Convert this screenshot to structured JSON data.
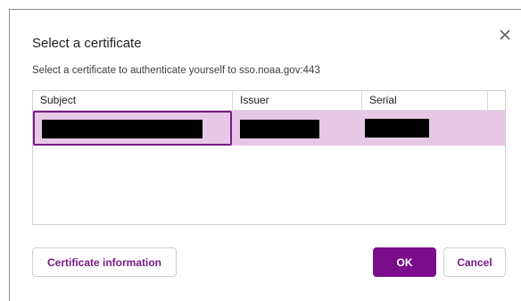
{
  "dialog": {
    "title": "Select a certificate",
    "description": "Select a certificate to authenticate yourself to sso.noaa.gov:443",
    "close_icon": "close-icon"
  },
  "table": {
    "columns": [
      "Subject",
      "Issuer",
      "Serial"
    ],
    "rows": [
      {
        "subject": "",
        "issuer": "",
        "serial": "",
        "selected": true,
        "redacted": true
      }
    ]
  },
  "buttons": {
    "certificate_information": "Certificate information",
    "ok": "OK",
    "cancel": "Cancel"
  },
  "colors": {
    "accent": "#7a0d8a",
    "selected_row": "#e6c8e6",
    "redaction": "#000000"
  }
}
